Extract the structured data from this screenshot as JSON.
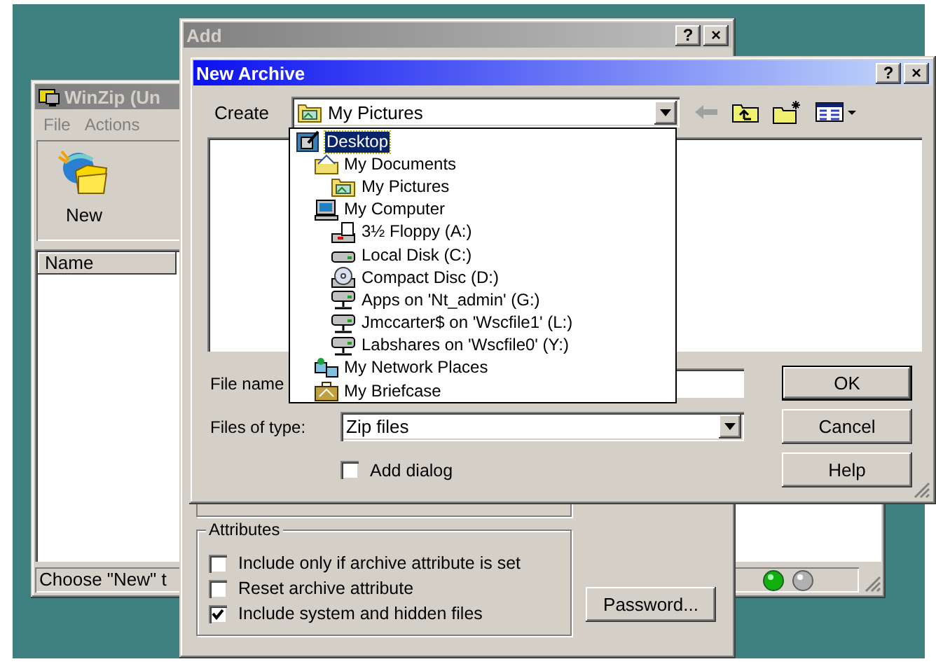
{
  "winzip_window": {
    "title": "WinZip (Un",
    "active": false,
    "menu": [
      "File",
      "Actions"
    ],
    "toolbar": [
      {
        "label": "New"
      }
    ],
    "columns": [
      "Name"
    ],
    "status_text": "Choose \"New\" t"
  },
  "add_window": {
    "title": "Add",
    "active": false,
    "title_buttons": [
      "?",
      "×"
    ],
    "attributes": {
      "title": "Attributes",
      "options": [
        {
          "label": "Include only if archive attribute is set",
          "checked": false
        },
        {
          "label": "Reset archive attribute",
          "checked": false
        },
        {
          "label": "Include system and hidden files",
          "checked": true
        }
      ]
    },
    "password_button": "Password..."
  },
  "new_archive": {
    "title": "New Archive",
    "active": true,
    "title_buttons": [
      "?",
      "×"
    ],
    "create_label": "Create",
    "location": "My Pictures",
    "file_name_label": "File name",
    "file_type_label": "Files of type:",
    "file_type": "Zip files",
    "add_dialog": {
      "label": "Add dialog",
      "checked": false
    },
    "buttons": [
      {
        "label": "OK",
        "default": true
      },
      {
        "label": "Cancel",
        "default": false
      },
      {
        "label": "Help",
        "default": false
      }
    ]
  },
  "location_dropdown": {
    "items": [
      {
        "label": "Desktop",
        "kind": "desktop",
        "selected": true,
        "children": [
          {
            "label": "My Documents",
            "kind": "documents",
            "selected": false,
            "children": [
              {
                "label": "My Pictures",
                "kind": "pictures",
                "selected": false
              }
            ]
          },
          {
            "label": "My Computer",
            "kind": "computer",
            "selected": false,
            "children": [
              {
                "label": "3½ Floppy (A:)",
                "kind": "floppy",
                "selected": false
              },
              {
                "label": "Local Disk (C:)",
                "kind": "disk",
                "selected": false
              },
              {
                "label": "Compact Disc (D:)",
                "kind": "cd",
                "selected": false
              },
              {
                "label": "Apps on 'Nt_admin' (G:)",
                "kind": "network_drive",
                "selected": false
              },
              {
                "label": "Jmccarter$ on 'Wscfile1' (L:)",
                "kind": "network_drive",
                "selected": false
              },
              {
                "label": "Labshares on 'Wscfile0' (Y:)",
                "kind": "network_drive",
                "selected": false
              }
            ]
          },
          {
            "label": "My Network Places",
            "kind": "network",
            "selected": false
          },
          {
            "label": "My Briefcase",
            "kind": "briefcase",
            "selected": false
          }
        ]
      }
    ]
  }
}
